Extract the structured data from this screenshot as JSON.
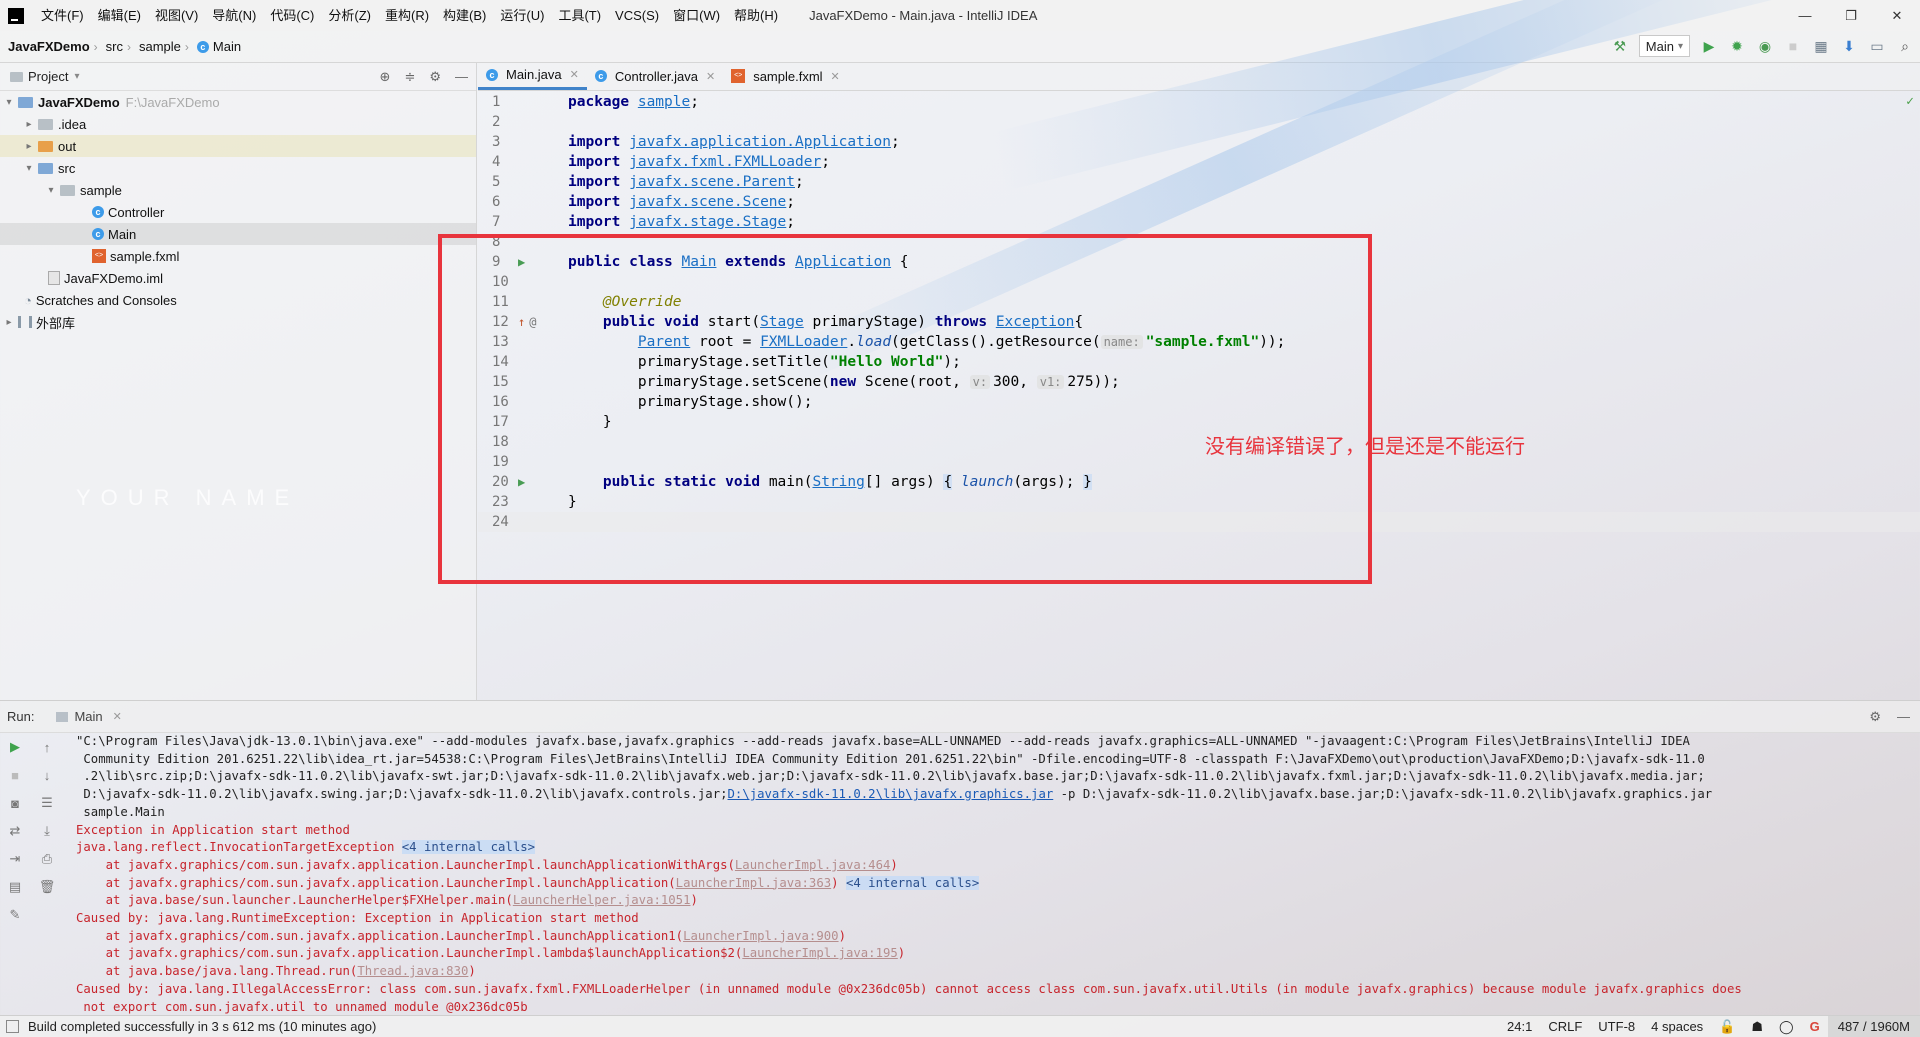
{
  "titlebar": {
    "menu": [
      "文件(F)",
      "编辑(E)",
      "视图(V)",
      "导航(N)",
      "代码(C)",
      "分析(Z)",
      "重构(R)",
      "构建(B)",
      "运行(U)",
      "工具(T)",
      "VCS(S)",
      "窗口(W)",
      "帮助(H)"
    ],
    "window_title": "JavaFXDemo - Main.java - IntelliJ IDEA",
    "minimize": "—",
    "restore": "❐",
    "close": "✕"
  },
  "navbar": {
    "crumbs": [
      "JavaFXDemo",
      "src",
      "sample",
      "Main"
    ],
    "run_config": "Main"
  },
  "project": {
    "header": "Project",
    "tree": [
      {
        "label": "JavaFXDemo",
        "hint": "F:\\JavaFXDemo"
      },
      {
        "label": ".idea"
      },
      {
        "label": "out"
      },
      {
        "label": "src"
      },
      {
        "label": "sample"
      },
      {
        "label": "Controller"
      },
      {
        "label": "Main"
      },
      {
        "label": "sample.fxml"
      },
      {
        "label": "JavaFXDemo.iml"
      },
      {
        "label": "Scratches and Consoles"
      },
      {
        "label": "外部库"
      }
    ]
  },
  "editor_tabs": [
    "Main.java",
    "Controller.java",
    "sample.fxml"
  ],
  "code": {
    "line_numbers": [
      "1",
      "2",
      "3",
      "4",
      "5",
      "6",
      "7",
      "8",
      "9",
      "10",
      "11",
      "12",
      "13",
      "14",
      "15",
      "16",
      "17",
      "18",
      "19",
      "20",
      "23",
      "24"
    ],
    "l1_kw": "package",
    "l1_pkg": "sample",
    "semi": ";",
    "import_kw": "import",
    "imports": [
      "javafx.application.Application",
      "javafx.fxml.FXMLLoader",
      "javafx.scene.Parent",
      "javafx.scene.Scene",
      "javafx.stage.Stage"
    ],
    "l9": {
      "kw1": "public",
      "kw2": "class",
      "name": "Main",
      "kw3": "extends",
      "sup": "Application",
      "tail": " {"
    },
    "l11": "@Override",
    "l12": {
      "kw1": "public",
      "kw2": "void",
      "a": " start(",
      "type": "Stage",
      "b": " primaryStage) ",
      "kw3": "throws",
      "exc": "Exception",
      "c": "{"
    },
    "l13": {
      "type": "Parent",
      "a": " root = ",
      "cls": "FXMLLoader",
      "dot": ".",
      "m": "load",
      "b": "(getClass().getResource(",
      "hint": "name:",
      "str": "\"sample.fxml\"",
      "c": "));"
    },
    "l14": {
      "a": "primaryStage.setTitle(",
      "str": "\"Hello World\"",
      "b": ");"
    },
    "l15": {
      "a": "primaryStage.setScene(",
      "kw": "new",
      "b": " Scene(root, ",
      "hint1": "v:",
      "n1": "300,",
      "hint2": "v1:",
      "n2": "275));"
    },
    "l16": "primaryStage.show();",
    "l17": "}",
    "l20": {
      "kw1": "public",
      "kw2": "static",
      "kw3": "void",
      "a": " main(",
      "type": "String",
      "b": "[] args) ",
      "f1": "{",
      "m": "launch",
      "c": "(args); ",
      "f2": "}"
    },
    "l23": "}"
  },
  "annotation": "没有编译错误了，但是还是不能运行",
  "watermark": "YOUR NAME",
  "run": {
    "label": "Run:",
    "tab": "Main",
    "console": {
      "cmd": [
        "\"C:\\Program Files\\Java\\jdk-13.0.1\\bin\\java.exe\" --add-modules javafx.base,javafx.graphics --add-reads javafx.base=ALL-UNNAMED --add-reads javafx.graphics=ALL-UNNAMED \"-javaagent:C:\\Program Files\\JetBrains\\IntelliJ IDEA",
        " Community Edition 201.6251.22\\lib\\idea_rt.jar=54538:C:\\Program Files\\JetBrains\\IntelliJ IDEA Community Edition 201.6251.22\\bin\" -Dfile.encoding=UTF-8 -classpath F:\\JavaFXDemo\\out\\production\\JavaFXDemo;D:\\javafx-sdk-11.0",
        " .2\\lib\\src.zip;D:\\javafx-sdk-11.0.2\\lib\\javafx-swt.jar;D:\\javafx-sdk-11.0.2\\lib\\javafx.web.jar;D:\\javafx-sdk-11.0.2\\lib\\javafx.base.jar;D:\\javafx-sdk-11.0.2\\lib\\javafx.fxml.jar;D:\\javafx-sdk-11.0.2\\lib\\javafx.media.jar;",
        " D:\\javafx-sdk-11.0.2\\lib\\javafx.swing.jar;D:\\javafx-sdk-11.0.2\\lib\\javafx.controls.jar;"
      ],
      "cmd_link": "D:\\javafx-sdk-11.0.2\\lib\\javafx.graphics.jar",
      "cmd_tail": " -p D:\\javafx-sdk-11.0.2\\lib\\javafx.base.jar;D:\\javafx-sdk-11.0.2\\lib\\javafx.graphics.jar",
      "cmd_main": " sample.Main",
      "e1": "Exception in Application start method",
      "e2": "java.lang.reflect.InvocationTargetException",
      "internal4": "<4 internal calls>",
      "at1": "    at javafx.graphics/com.sun.javafx.application.LauncherImpl.launchApplicationWithArgs(",
      "at1_link": "LauncherImpl.java:464",
      "at2": "    at javafx.graphics/com.sun.javafx.application.LauncherImpl.launchApplication(",
      "at2_link": "LauncherImpl.java:363",
      "at3": "    at java.base/sun.launcher.LauncherHelper$FXHelper.main(",
      "at3_link": "LauncherHelper.java:1051",
      "c1": "Caused by: java.lang.RuntimeException: Exception in Application start method",
      "at4": "    at javafx.graphics/com.sun.javafx.application.LauncherImpl.launchApplication1(",
      "at4_link": "LauncherImpl.java:900",
      "at5": "    at javafx.graphics/com.sun.javafx.application.LauncherImpl.lambda$launchApplication$2(",
      "at5_link": "LauncherImpl.java:195",
      "at6": "    at java.base/java.lang.Thread.run(",
      "at6_link": "Thread.java:830",
      "c2": "Caused by: java.lang.IllegalAccessError: class com.sun.javafx.fxml.FXMLLoaderHelper (in unnamed module @0x236dc05b) cannot access class com.sun.javafx.util.Utils (in module javafx.graphics) because module javafx.graphics does",
      "c2b": " not export com.sun.javafx.util to unnamed module @0x236dc05b",
      "close_paren": ")"
    }
  },
  "status": {
    "message": "Build completed successfully in 3 s 612 ms (10 minutes ago)",
    "position": "24:1",
    "line_sep": "CRLF",
    "encoding": "UTF-8",
    "indent": "4 spaces",
    "memory": "487 / 1960M"
  }
}
